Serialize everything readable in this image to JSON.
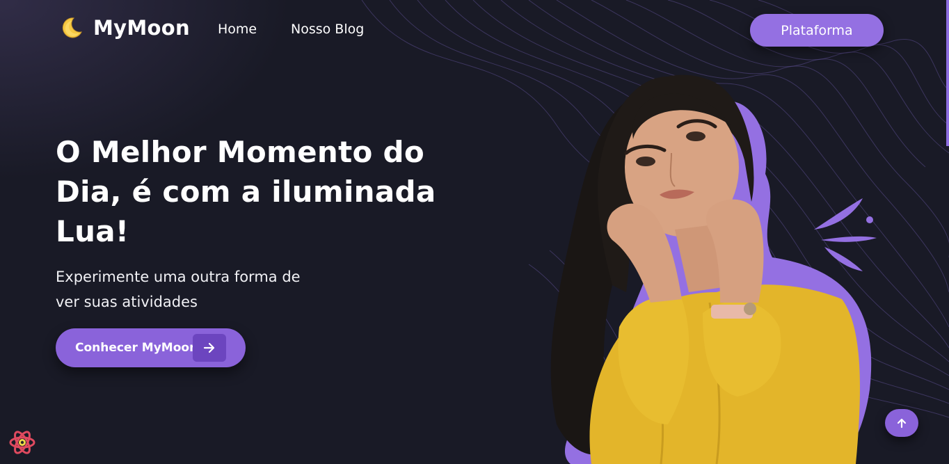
{
  "header": {
    "brand": "MyMoon",
    "nav": [
      {
        "label": "Home"
      },
      {
        "label": "Nosso Blog"
      }
    ],
    "platform_button": "Plataforma"
  },
  "hero": {
    "title_lines": [
      "O Melhor Momento do",
      "Dia, é com a iluminada",
      "Lua!"
    ],
    "subtitle_lines": [
      "Experimente uma outra forma de",
      "ver suas atividades"
    ],
    "cta_label": "Conhecer MyMoon"
  },
  "icons": {
    "logo": "crescent-moon-icon",
    "cta": "arrow-right-icon",
    "scroll_top": "arrow-up-icon",
    "devtools": "react-icon"
  },
  "colors": {
    "background": "#191a26",
    "accent": "#9470e2",
    "accent_dark": "#6c45bf",
    "sweater": "#e3b52a",
    "text": "#ffffff"
  }
}
